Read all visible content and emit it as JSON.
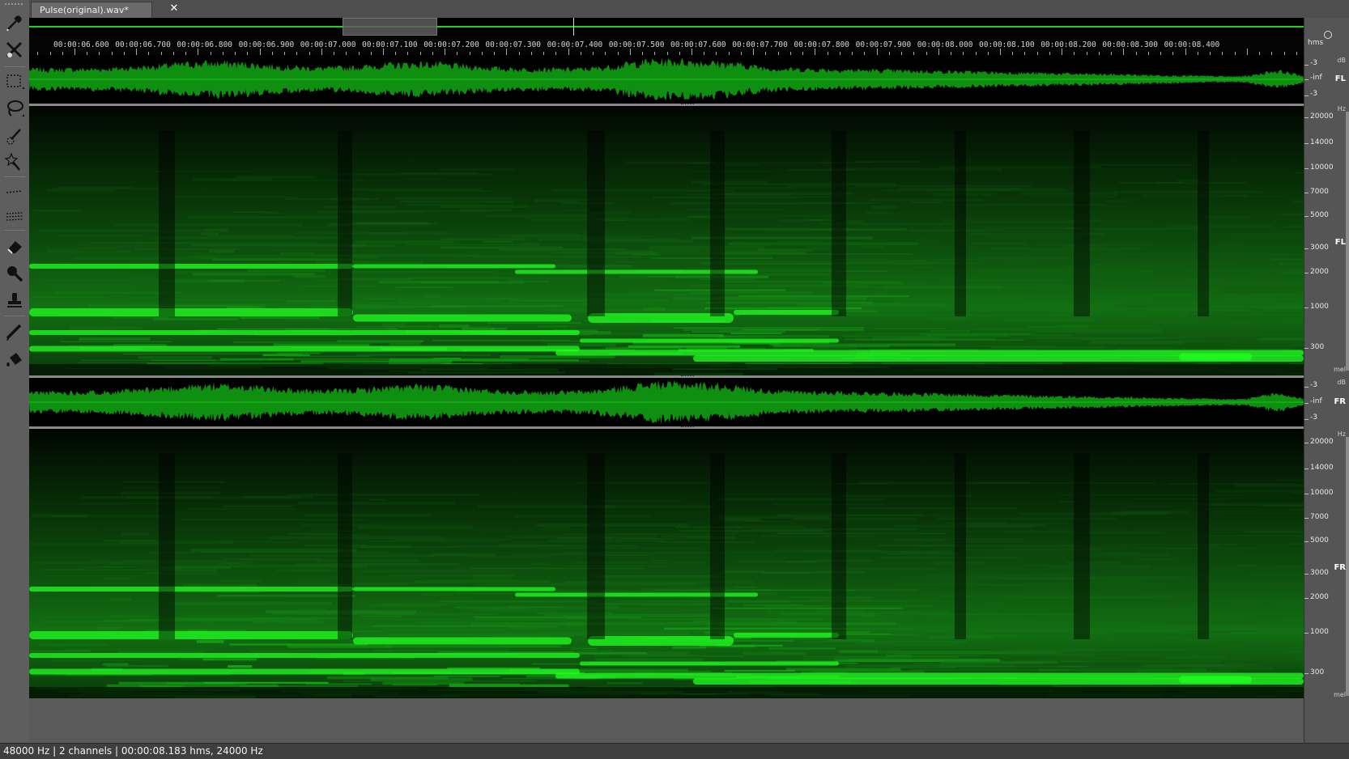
{
  "file_tab": {
    "title": "Pulse(original).wav*",
    "close_glyph": "✕"
  },
  "toolbar": {
    "tools": [
      "eyedropper-icon",
      "scalpel-icon",
      "rect-select-icon",
      "lasso-icon",
      "brush-select-icon",
      "magic-wand-icon",
      "harmonic-line-icon",
      "multi-line-icon",
      "eraser-icon",
      "magnifier-icon",
      "clone-stamp-icon",
      "pencil-icon",
      "paint-bucket-icon"
    ]
  },
  "timeline": {
    "unit": "hms",
    "labels": [
      "00:00:06.600",
      "00:00:06.700",
      "00:00:06.800",
      "00:00:06.900",
      "00:00:07.000",
      "00:00:07.100",
      "00:00:07.200",
      "00:00:07.300",
      "00:00:07.400",
      "00:00:07.500",
      "00:00:07.600",
      "00:00:07.700",
      "00:00:07.800",
      "00:00:07.900",
      "00:00:08.000",
      "00:00:08.100",
      "00:00:08.200",
      "00:00:08.300",
      "00:00:08.400"
    ]
  },
  "channels": [
    {
      "name": "FL",
      "amp_labels": [
        "-3",
        "-inf",
        "-3"
      ],
      "amp_unit": "dB",
      "freq_unit": "Hz",
      "freq_labels": [
        "20000",
        "14000",
        "10000",
        "7000",
        "5000",
        "3000",
        "2000",
        "1000",
        "300"
      ],
      "scale_unit": "mel"
    },
    {
      "name": "FR",
      "amp_labels": [
        "-3",
        "-inf",
        "-3"
      ],
      "amp_unit": "dB",
      "freq_unit": "Hz",
      "freq_labels": [
        "20000",
        "14000",
        "10000",
        "7000",
        "5000",
        "3000",
        "2000",
        "1000",
        "300"
      ],
      "scale_unit": "mel"
    }
  ],
  "status": {
    "text": "48000 Hz | 2 channels | 00:00:08.183 hms, 24000 Hz"
  },
  "colors": {
    "waveform": "#0f8f0f",
    "spectrum": "#22ff22",
    "overview": "#1ad51a"
  }
}
